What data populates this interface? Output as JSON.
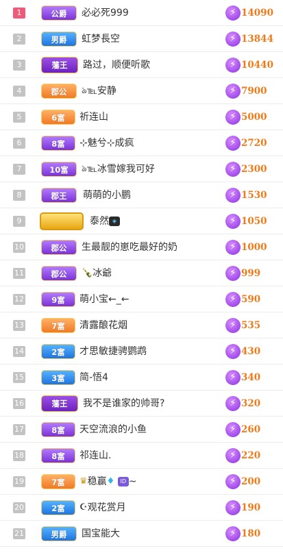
{
  "rows": [
    {
      "rank": "1",
      "badge": "公爵",
      "name": "必必死999",
      "amount": "14090"
    },
    {
      "rank": "2",
      "badge": "男爵",
      "name": "虹梦長空",
      "amount": "13844"
    },
    {
      "rank": "3",
      "badge": "藩王",
      "name": "路过，顺便听歌",
      "amount": "10440"
    },
    {
      "rank": "4",
      "badge": "郡公",
      "name": "℡安静",
      "amount": "7900"
    },
    {
      "rank": "5",
      "badge": "6富",
      "name": "祈连山",
      "amount": "5000"
    },
    {
      "rank": "6",
      "badge": "8富",
      "name": "⊹魅兮⊹成疯",
      "amount": "2720"
    },
    {
      "rank": "7",
      "badge": "10富",
      "name": "℡冰雪嫁我可好",
      "amount": "2300"
    },
    {
      "rank": "8",
      "badge": "郡王",
      "name": "萌萌的小鹏",
      "amount": "1530"
    },
    {
      "rank": "9",
      "badge": "",
      "name": "泰然",
      "amount": "1050"
    },
    {
      "rank": "10",
      "badge": "郡公",
      "name": "生最靓的崽吃最好的奶",
      "amount": "1000"
    },
    {
      "rank": "11",
      "badge": "郡公",
      "name": "冰爺",
      "amount": "999"
    },
    {
      "rank": "12",
      "badge": "9富",
      "name": "萌小宝←_←",
      "amount": "590"
    },
    {
      "rank": "13",
      "badge": "7富",
      "name": "清露酿花烟",
      "amount": "535"
    },
    {
      "rank": "14",
      "badge": "2富",
      "name": "才思敏捷骋鹦鹉",
      "amount": "430"
    },
    {
      "rank": "15",
      "badge": "3富",
      "name": "简-悟4",
      "amount": "340"
    },
    {
      "rank": "16",
      "badge": "藩王",
      "name": "我不是谁家的帅哥?",
      "amount": "320"
    },
    {
      "rank": "17",
      "badge": "8富",
      "name": "天空流浪的小鱼",
      "amount": "260"
    },
    {
      "rank": "18",
      "badge": "8富",
      "name": "祁连山.",
      "amount": "220"
    },
    {
      "rank": "19",
      "badge": "7富",
      "name": "稳赢",
      "amount": "200"
    },
    {
      "rank": "20",
      "badge": "2富",
      "name": "观花赏月",
      "amount": "190"
    },
    {
      "rank": "21",
      "badge": "男爵",
      "name": "国宝能大",
      "amount": "180"
    }
  ],
  "icons": {
    "amount_icon": "lightning-icon",
    "row4_prefix": "flame-icon",
    "row7_prefix": "flame-icon",
    "row11_prefix": "bottle-icon",
    "row19_prefix": "crown-icon",
    "row19_suffix1": "diamond-icon",
    "row19_suffix2": "id-badge-icon",
    "row19_tail": "~",
    "row20_prefix": "moon-icon",
    "row9_suffix": "gem-icon"
  },
  "colors": {
    "amount": "#f07a18",
    "rank_top": "#f05a78",
    "rank_default": "#c3c3c3",
    "badge_purple": "#8b40e0",
    "badge_blue": "#2a86f0",
    "badge_orange": "#f28a34"
  }
}
